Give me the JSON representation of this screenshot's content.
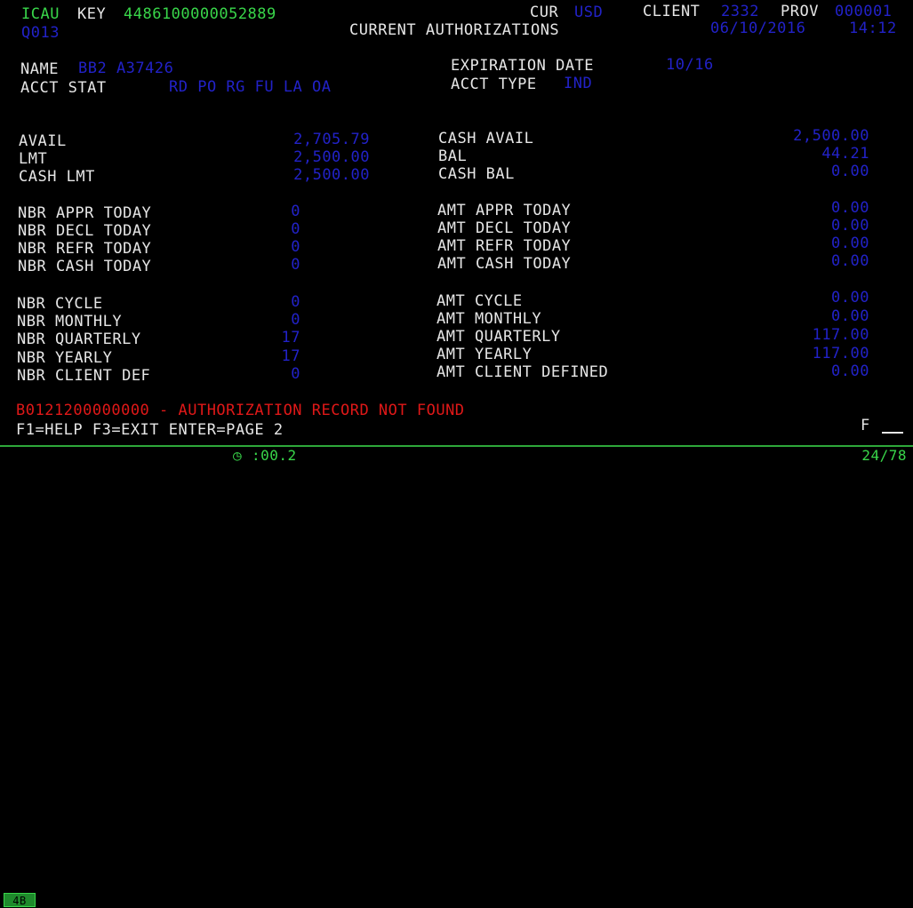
{
  "header": {
    "icau": "ICAU",
    "key_label": "KEY",
    "key_value": "4486100000052889",
    "code": "Q013",
    "cur_label": "CUR",
    "cur_value": "USD",
    "client_label": "CLIENT",
    "client_value": "2332",
    "prov_label": "PROV",
    "prov_value": "000001",
    "title": "CURRENT AUTHORIZATIONS",
    "date": "06/10/2016",
    "time": "14:12"
  },
  "account": {
    "name_label": "NAME",
    "name_value": "BB2 A37426",
    "stat_label": "ACCT STAT",
    "stat_value": "RD PO RG FU LA OA",
    "exp_label": "EXPIRATION DATE",
    "exp_value": "10/16",
    "type_label": "ACCT TYPE",
    "type_value": "IND"
  },
  "balances_left": [
    {
      "label": "AVAIL",
      "value": "2,705.79"
    },
    {
      "label": "LMT",
      "value": "2,500.00"
    },
    {
      "label": "CASH LMT",
      "value": "2,500.00"
    }
  ],
  "balances_right": [
    {
      "label": "CASH AVAIL",
      "value": "2,500.00"
    },
    {
      "label": "BAL",
      "value": "44.21"
    },
    {
      "label": "CASH BAL",
      "value": "0.00"
    }
  ],
  "today_left": [
    {
      "label": "NBR APPR TODAY",
      "value": "0"
    },
    {
      "label": "NBR DECL TODAY",
      "value": "0"
    },
    {
      "label": "NBR REFR TODAY",
      "value": "0"
    },
    {
      "label": "NBR CASH TODAY",
      "value": "0"
    }
  ],
  "today_right": [
    {
      "label": "AMT APPR TODAY",
      "value": "0.00"
    },
    {
      "label": "AMT DECL TODAY",
      "value": "0.00"
    },
    {
      "label": "AMT REFR TODAY",
      "value": "0.00"
    },
    {
      "label": "AMT CASH TODAY",
      "value": "0.00"
    }
  ],
  "period_left": [
    {
      "label": "NBR CYCLE",
      "value": "0"
    },
    {
      "label": "NBR MONTHLY",
      "value": "0"
    },
    {
      "label": "NBR QUARTERLY",
      "value": "17"
    },
    {
      "label": "NBR YEARLY",
      "value": "17"
    },
    {
      "label": "NBR CLIENT DEF",
      "value": "0"
    }
  ],
  "period_right": [
    {
      "label": "AMT CYCLE",
      "value": "0.00"
    },
    {
      "label": "AMT MONTHLY",
      "value": "0.00"
    },
    {
      "label": "AMT QUARTERLY",
      "value": "117.00"
    },
    {
      "label": "AMT YEARLY",
      "value": "117.00"
    },
    {
      "label": "AMT CLIENT DEFINED",
      "value": "0.00"
    }
  ],
  "message": "B0121200000000 - AUTHORIZATION RECORD NOT FOUND",
  "fkeys": "F1=HELP F3=EXIT ENTER=PAGE 2",
  "field_label": "F",
  "status": {
    "conn": "4B",
    "timer": ":00.2",
    "cursor": "24/78"
  },
  "colors": {
    "background": "#000000",
    "label": "#e6e6e6",
    "value": "#2222c8",
    "key": "#39d64a",
    "error": "#e01818"
  }
}
